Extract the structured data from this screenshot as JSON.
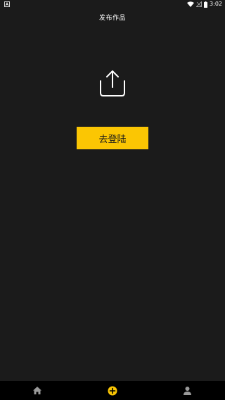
{
  "status_bar": {
    "time": "3:02",
    "left_icon": "a-notification-icon",
    "icons": [
      "wifi-icon",
      "signal-icon",
      "battery-icon"
    ]
  },
  "header": {
    "title": "发布作品"
  },
  "main": {
    "icon": "upload-icon",
    "login_button_label": "去登陆"
  },
  "bottom_nav": {
    "items": [
      {
        "name": "home",
        "icon": "home-icon",
        "active": false
      },
      {
        "name": "publish",
        "icon": "add-circle-icon",
        "active": true
      },
      {
        "name": "profile",
        "icon": "person-icon",
        "active": false
      }
    ]
  },
  "colors": {
    "background": "#1b1b1b",
    "accent": "#fbc603",
    "nav_background": "#000000",
    "inactive_icon": "#9a9a9a"
  }
}
